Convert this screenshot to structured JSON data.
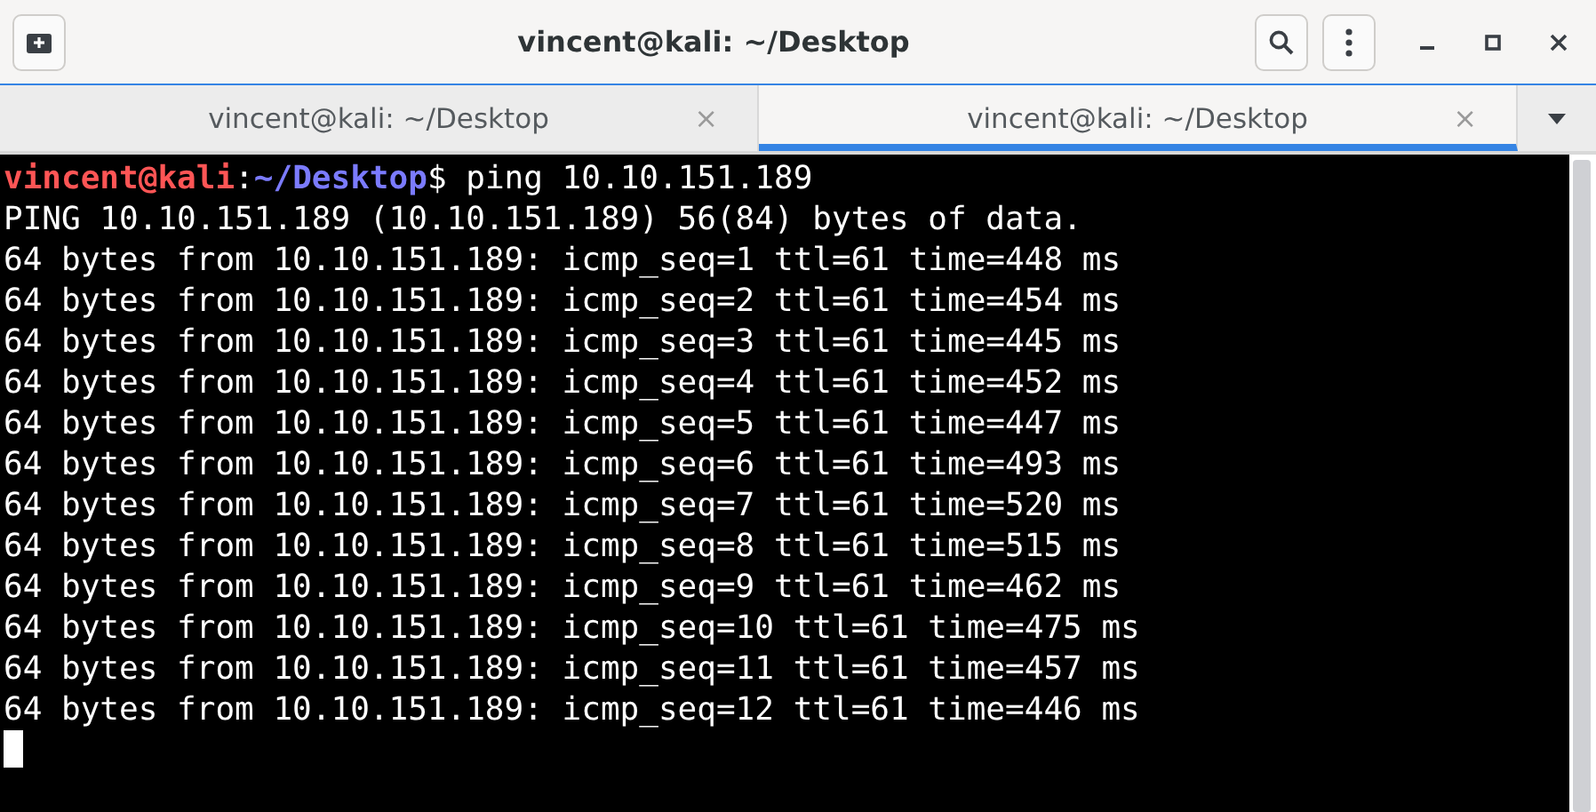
{
  "window": {
    "title": "vincent@kali: ~/Desktop"
  },
  "tabs": [
    {
      "label": "vincent@kali: ~/Desktop",
      "selected": false,
      "close": "×"
    },
    {
      "label": "vincent@kali: ~/Desktop",
      "selected": true,
      "close": "×"
    }
  ],
  "terminal": {
    "lines": [
      {
        "kind": "prompt",
        "user_host": "vincent@kali",
        "separator": ":",
        "path": "~/Desktop",
        "symbol": "$",
        "command": " ping 10.10.151.189"
      },
      {
        "kind": "output",
        "text": "PING 10.10.151.189 (10.10.151.189) 56(84) bytes of data."
      },
      {
        "kind": "output",
        "text": "64 bytes from 10.10.151.189: icmp_seq=1 ttl=61 time=448 ms"
      },
      {
        "kind": "output",
        "text": "64 bytes from 10.10.151.189: icmp_seq=2 ttl=61 time=454 ms"
      },
      {
        "kind": "output",
        "text": "64 bytes from 10.10.151.189: icmp_seq=3 ttl=61 time=445 ms"
      },
      {
        "kind": "output",
        "text": "64 bytes from 10.10.151.189: icmp_seq=4 ttl=61 time=452 ms"
      },
      {
        "kind": "output",
        "text": "64 bytes from 10.10.151.189: icmp_seq=5 ttl=61 time=447 ms"
      },
      {
        "kind": "output",
        "text": "64 bytes from 10.10.151.189: icmp_seq=6 ttl=61 time=493 ms"
      },
      {
        "kind": "output",
        "text": "64 bytes from 10.10.151.189: icmp_seq=7 ttl=61 time=520 ms"
      },
      {
        "kind": "output",
        "text": "64 bytes from 10.10.151.189: icmp_seq=8 ttl=61 time=515 ms"
      },
      {
        "kind": "output",
        "text": "64 bytes from 10.10.151.189: icmp_seq=9 ttl=61 time=462 ms"
      },
      {
        "kind": "output",
        "text": "64 bytes from 10.10.151.189: icmp_seq=10 ttl=61 time=475 ms"
      },
      {
        "kind": "output",
        "text": "64 bytes from 10.10.151.189: icmp_seq=11 ttl=61 time=457 ms"
      },
      {
        "kind": "output",
        "text": "64 bytes from 10.10.151.189: icmp_seq=12 ttl=61 time=446 ms"
      },
      {
        "kind": "cursor"
      }
    ]
  }
}
